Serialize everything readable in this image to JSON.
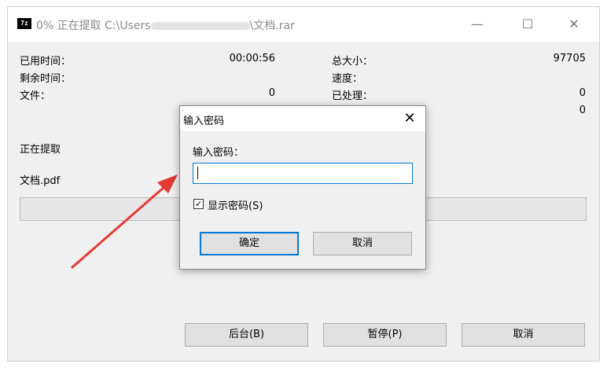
{
  "window": {
    "title_prefix": "0% 正在提取 C:\\Users",
    "title_suffix": "\\文档.rar",
    "app_icon_text": "7z",
    "controls": {
      "minimize": "—",
      "maximize": "☐",
      "close": "✕"
    }
  },
  "stats": {
    "elapsed_label": "已用时间：",
    "elapsed_value": "00:00:56",
    "remaining_label": "剩余时间：",
    "files_label": "文件：",
    "files_value": "0",
    "total_size_label": "总大小：",
    "total_size_value": "97705",
    "speed_label": "速度：",
    "processed_label": "已处理：",
    "processed_value": "0",
    "hidden_row_value": "0"
  },
  "status": {
    "extracting_label": "正在提取",
    "current_file": "文档.pdf"
  },
  "buttons": {
    "background": "后台(B)",
    "pause": "暂停(P)",
    "cancel": "取消"
  },
  "dialog": {
    "title": "输入密码",
    "close": "✕",
    "field_label": "输入密码：",
    "password_value": "",
    "show_password_label": "显示密码(S)",
    "show_password_checked": true,
    "ok": "确定",
    "cancel": "取消"
  },
  "colors": {
    "accent": "#0078d7",
    "arrow": "#e53935",
    "window_bg": "#f0f0f0"
  }
}
